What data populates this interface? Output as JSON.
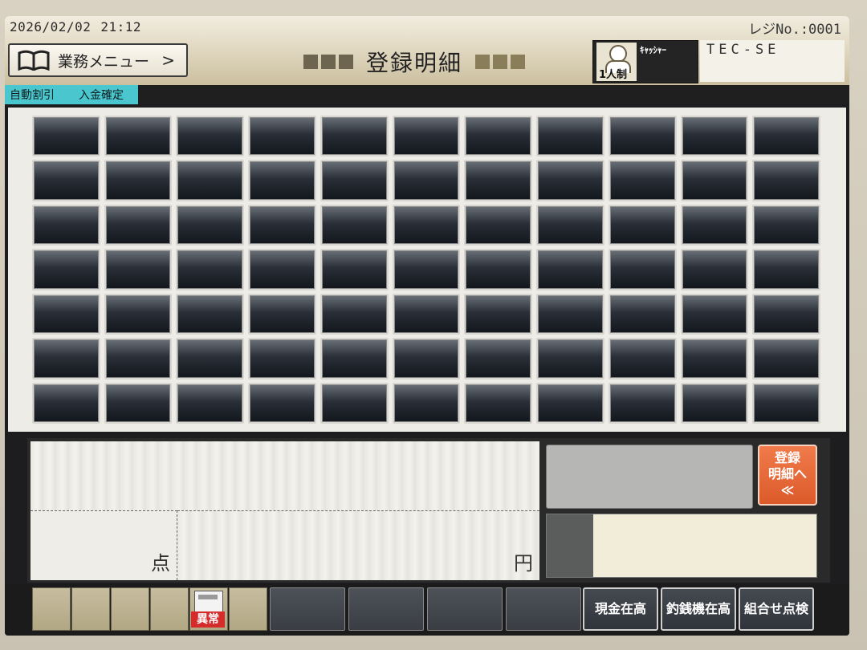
{
  "header": {
    "date": "2026/02/02",
    "time": "21:12",
    "register_no": "レジNo.:0001",
    "menu_button_label": "業務メニュー",
    "menu_chevron": ">",
    "title": "登録明細",
    "cashier_label": "ｷｬｯｼｬｰ",
    "cashier_mode": "1人制",
    "cashier_name": "TEC-SE"
  },
  "status_bar": {
    "tags": [
      "自動割引",
      "入金確定"
    ]
  },
  "item_grid": {
    "rows": 7,
    "columns": 11
  },
  "info_panel": {
    "quantity_unit": "点",
    "amount_unit": "円",
    "register_detail_button": [
      "登録",
      "明細へ",
      "≪"
    ]
  },
  "function_bar": {
    "alert_label": "異常",
    "buttons": [
      "現金在高",
      "釣銭機在高",
      "組合せ点検"
    ]
  },
  "colors": {
    "status_tag": "#4ac6cf",
    "register_button": "#e8663a",
    "alert_red": "#d52b2b"
  },
  "icons": {
    "menu": "book-icon",
    "cashier": "person-icon",
    "alert": "printer-alert-icon"
  }
}
